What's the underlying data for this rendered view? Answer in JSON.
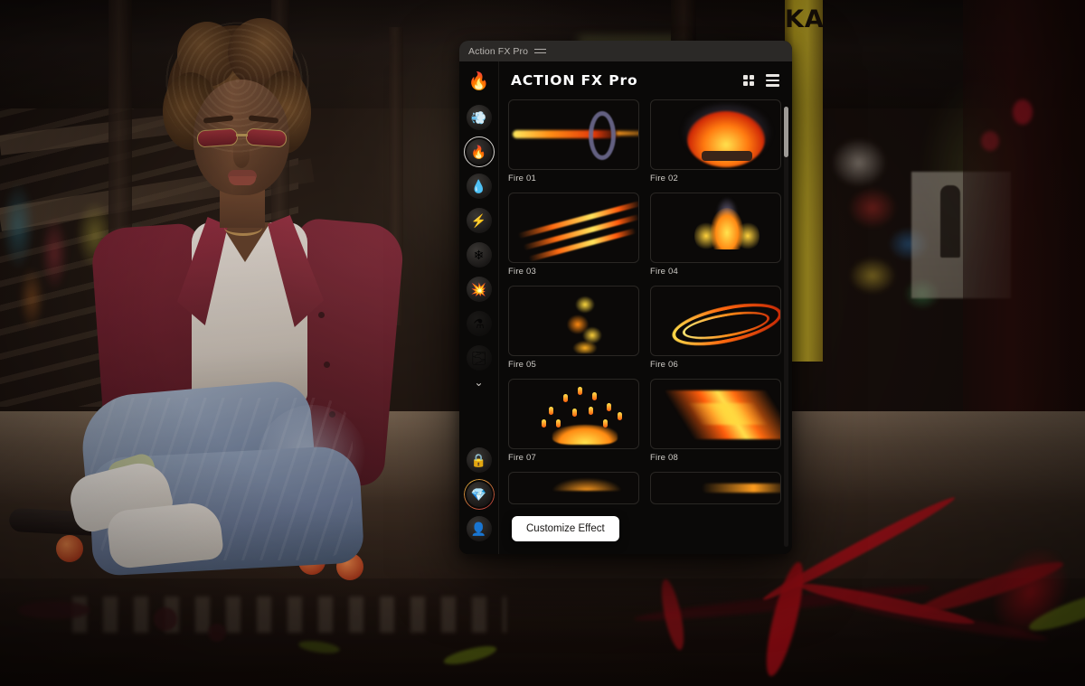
{
  "window": {
    "title": "Action FX Pro",
    "menu_icon": "hamburger-menu-icon"
  },
  "panel": {
    "header": {
      "brand": "ACTION FX Pro",
      "logo_icon": "flame-logo-icon",
      "grid_view_icon": "grid-view-icon",
      "list_view_icon": "list-view-icon"
    },
    "sidebar": {
      "items": [
        {
          "name": "smoke",
          "icon": "smoke-icon",
          "glyph": "💨",
          "selected": false,
          "dim": false
        },
        {
          "name": "fire",
          "icon": "fire-icon",
          "glyph": "🔥",
          "selected": true,
          "dim": false
        },
        {
          "name": "water",
          "icon": "water-drop-icon",
          "glyph": "💧",
          "selected": false,
          "dim": false
        },
        {
          "name": "electricity",
          "icon": "lightning-bolt-icon",
          "glyph": "⚡",
          "selected": false,
          "dim": false
        },
        {
          "name": "snow",
          "icon": "snow-icon",
          "glyph": "❄",
          "selected": false,
          "dim": false
        },
        {
          "name": "explosion",
          "icon": "explosion-icon",
          "glyph": "💥",
          "selected": false,
          "dim": false
        },
        {
          "name": "magic",
          "icon": "magic-icon",
          "glyph": "⚗",
          "selected": false,
          "dim": true
        },
        {
          "name": "more",
          "icon": "more-effects-icon",
          "glyph": "🌫",
          "selected": false,
          "dim": true
        }
      ],
      "expand_icon": "chevron-down-icon",
      "bottom_items": [
        {
          "name": "locked",
          "icon": "lock-icon",
          "glyph": "🔒",
          "ring": "none"
        },
        {
          "name": "premium",
          "icon": "diamond-icon",
          "glyph": "💎",
          "ring": "gold-red"
        },
        {
          "name": "account",
          "icon": "avatar-icon",
          "glyph": "👤",
          "ring": "none"
        }
      ]
    },
    "effects": [
      {
        "label": "Fire 01",
        "art": "comet-ring"
      },
      {
        "label": "Fire 02",
        "art": "bonfire"
      },
      {
        "label": "Fire 03",
        "art": "claw-slashes"
      },
      {
        "label": "Fire 04",
        "art": "ornament"
      },
      {
        "label": "Fire 05",
        "art": "swirl"
      },
      {
        "label": "Fire 06",
        "art": "rings"
      },
      {
        "label": "Fire 07",
        "art": "burst"
      },
      {
        "label": "Fire 08",
        "art": "streak"
      }
    ],
    "cta": {
      "label": "Customize Effect"
    },
    "scrollbar": {
      "position": "top"
    }
  },
  "colors": {
    "accent_fire": "#ff6a10",
    "accent_yellow": "#ffe34d",
    "panel_bg": "#0a0908",
    "titlebar_bg": "#2b2927",
    "cta_bg": "#ffffff",
    "selection_ring": "#d7d4d0",
    "premium_ring_from": "#e0b43a",
    "premium_ring_to": "#b8323c"
  },
  "background": {
    "scene": "woman-on-skateboard-in-graffiti-underpass",
    "graffiti_text": "KARANIEN"
  }
}
